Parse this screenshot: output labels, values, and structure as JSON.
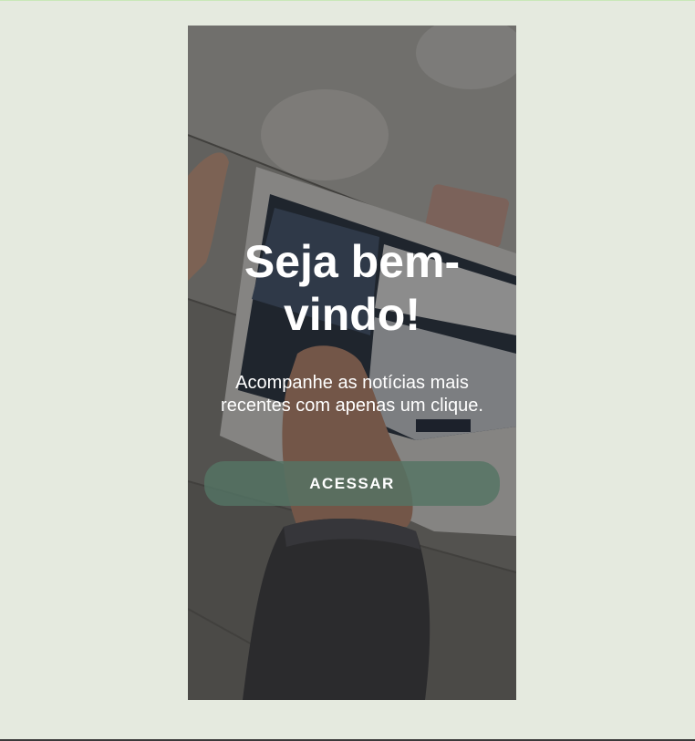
{
  "welcome": {
    "title": "Seja bem-vindo!",
    "subtitle": "Acompanhe as notícias mais recentes com apenas um clique.",
    "button_label": "ACESSAR"
  },
  "colors": {
    "page_background": "#e5eadf",
    "button_background": "#547464",
    "text": "#ffffff"
  }
}
